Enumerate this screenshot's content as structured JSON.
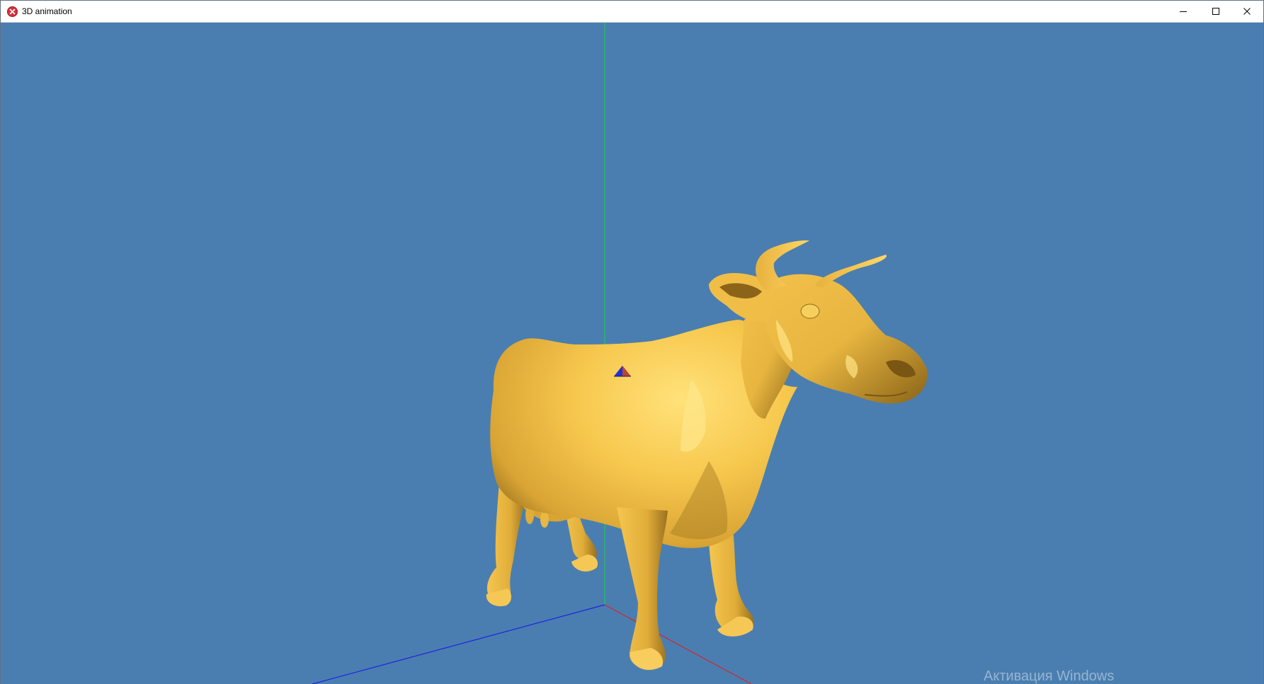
{
  "window": {
    "title": "3D animation",
    "app_icon": "app-error-icon",
    "controls": [
      {
        "name": "minimize",
        "icon": "minimize-icon"
      },
      {
        "name": "maximize",
        "icon": "maximize-icon"
      },
      {
        "name": "close",
        "icon": "close-icon"
      }
    ]
  },
  "viewport": {
    "background_color": "#4a7eb0",
    "model": "cow",
    "model_color": "#f2c34d",
    "axes": {
      "x_color": "#e02020",
      "y_color": "#19d24a",
      "z_color": "#1f22e0"
    }
  },
  "overlay": {
    "watermark": "Активация Windows"
  }
}
